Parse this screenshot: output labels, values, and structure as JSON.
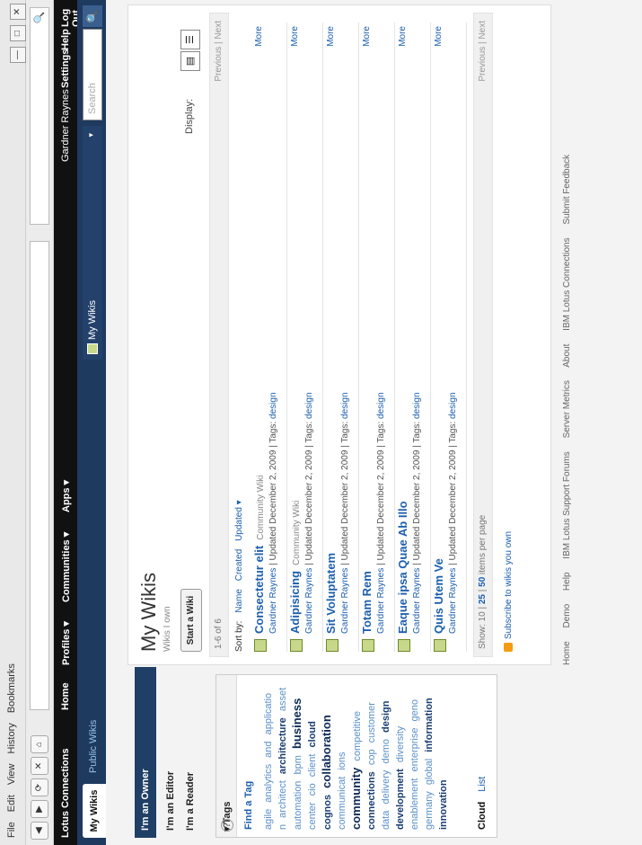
{
  "browser": {
    "menu": [
      "File",
      "Edit",
      "View",
      "History",
      "Bookmarks"
    ],
    "window_buttons": [
      "—",
      "□",
      "✕"
    ],
    "nav_buttons": [
      "◀",
      "▶",
      "⟳",
      "✕",
      "⌂"
    ],
    "search_icon": "🔍"
  },
  "header": {
    "brand": "Lotus Connections",
    "nav": [
      "Home",
      "Profiles ▾",
      "Communities ▾",
      "Apps ▾"
    ],
    "user": "Gardner Raynes",
    "links": [
      "Settings",
      "Help",
      "Log Out"
    ]
  },
  "tabs": {
    "active": "My Wikis",
    "other": "Public Wikis"
  },
  "scope": {
    "label": "My Wikis",
    "caret": "▾"
  },
  "search": {
    "placeholder": "Search",
    "go_icon": "🔍"
  },
  "sidebar": {
    "owner": "I'm an Owner",
    "editor": "I'm an Editor",
    "reader": "I'm a Reader",
    "tags_title": "▾ Tags",
    "help": "?",
    "find_tag": "Find a Tag",
    "cloud": [
      {
        "t": "agile",
        "w": 0
      },
      {
        "t": "analytics",
        "w": 0
      },
      {
        "t": "and",
        "w": 0
      },
      {
        "t": "applicatio",
        "w": 0
      },
      {
        "t": "n",
        "w": 0
      },
      {
        "t": "architect",
        "w": 0
      },
      {
        "t": "architecture",
        "w": 1
      },
      {
        "t": "asset",
        "w": 0
      },
      {
        "t": "automation",
        "w": 0
      },
      {
        "t": "bpm",
        "w": 0
      },
      {
        "t": "business",
        "w": 2
      },
      {
        "t": "center",
        "w": 0
      },
      {
        "t": "cio",
        "w": 0
      },
      {
        "t": "client",
        "w": 0
      },
      {
        "t": "cloud",
        "w": 1
      },
      {
        "t": "cognos",
        "w": 1
      },
      {
        "t": "collaboration",
        "w": 2
      },
      {
        "t": "communicat",
        "w": 0
      },
      {
        "t": "ions",
        "w": 0
      },
      {
        "t": "community",
        "w": 2
      },
      {
        "t": "competitive",
        "w": 0
      },
      {
        "t": "connections",
        "w": 1
      },
      {
        "t": "cop",
        "w": 0
      },
      {
        "t": "customer",
        "w": 0
      },
      {
        "t": "data",
        "w": 0
      },
      {
        "t": "delivery",
        "w": 0
      },
      {
        "t": "demo",
        "w": 0
      },
      {
        "t": "design",
        "w": 1
      },
      {
        "t": "development",
        "w": 1
      },
      {
        "t": "diversity",
        "w": 0
      },
      {
        "t": "enablement",
        "w": 0
      },
      {
        "t": "enterprise",
        "w": 0
      },
      {
        "t": "geno",
        "w": 0
      },
      {
        "t": "germany",
        "w": 0
      },
      {
        "t": "global",
        "w": 0
      },
      {
        "t": "information",
        "w": 1
      },
      {
        "t": "innovation",
        "w": 1
      }
    ],
    "cloud_tab": "Cloud",
    "list_tab": "List"
  },
  "main": {
    "title": "My Wikis",
    "subtitle": "Wikis I own",
    "start_button": "Start a Wiki",
    "display_label": "Display:",
    "count": "1-6 of 6",
    "previous": "Previous",
    "next": "Next",
    "sort_by": "Sort by:",
    "sort_options": [
      "Name",
      "Created",
      "Updated ▾"
    ],
    "items": [
      {
        "title": "Consectetur elit",
        "kind": "Community Wiki",
        "owner": "Gardner Raynes",
        "updated": "Updated December 2, 2009",
        "tags_label": "Tags:",
        "tag": "design",
        "more": "More"
      },
      {
        "title": "Adipisicing",
        "kind": "Community Wiki",
        "owner": "Gardner Raynes",
        "updated": "Updated December 2, 2009",
        "tags_label": "Tags:",
        "tag": "design",
        "more": "More"
      },
      {
        "title": "Sit Voluptatem",
        "kind": "",
        "owner": "Gardner Raynes",
        "updated": "Updated December 2, 2009",
        "tags_label": "Tags:",
        "tag": "design",
        "more": "More"
      },
      {
        "title": "Totam Rem",
        "kind": "",
        "owner": "Gardner Raynes",
        "updated": "Updated December 2, 2009",
        "tags_label": "Tags:",
        "tag": "design",
        "more": "More"
      },
      {
        "title": "Eaque ipsa Quae Ab Illo",
        "kind": "",
        "owner": "Gardner Raynes",
        "updated": "Updated December 2, 2009",
        "tags_label": "Tags:",
        "tag": "design",
        "more": "More"
      },
      {
        "title": "Quis Utem Ve",
        "kind": "",
        "owner": "Gardner Raynes",
        "updated": "Updated December 2, 2009",
        "tags_label": "Tags:",
        "tag": "design",
        "more": "More"
      }
    ],
    "show_label": "Show:",
    "page_sizes": [
      "10",
      "25",
      "50"
    ],
    "items_per_page": "items per page",
    "subscribe": "Subscribe to wikis you own"
  },
  "footer": [
    "Home",
    "Demo",
    "Help",
    "IBM Lotus Support Forums",
    "Server Metrics",
    "About",
    "IBM Lotus Connections",
    "Submit Feedback"
  ]
}
